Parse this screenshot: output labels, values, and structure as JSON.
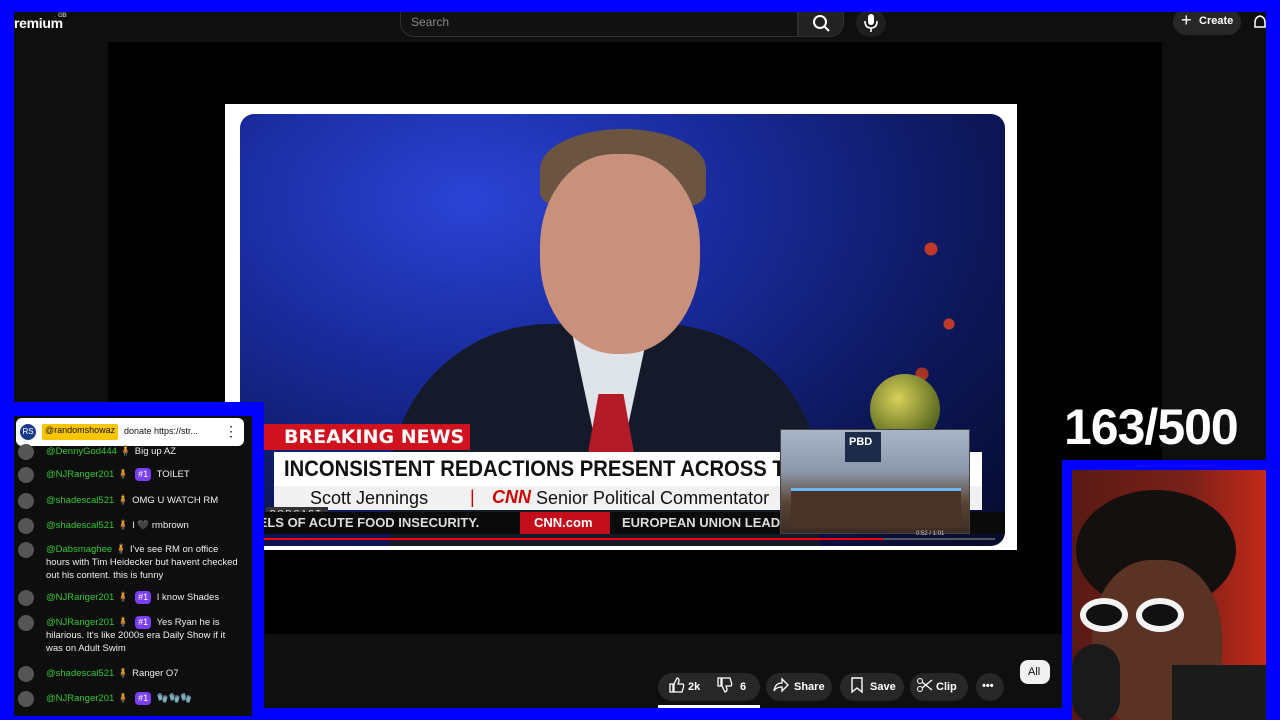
{
  "topbar": {
    "logo": "remium",
    "logo_sup": "GB",
    "search_placeholder": "Search",
    "create_label": "Create"
  },
  "video": {
    "breaking": "BREAKING NEWS",
    "headline": "INCONSISTENT REDACTIONS PRESENT ACROSS THE EPS",
    "subline_name": "Scott Jennings",
    "subline_sep": "|",
    "network": "CNN",
    "subline_title": "Senior Political Commentator",
    "podcast_tag": "PODCAST",
    "ticker_left": "VELS OF ACUTE FOOD INSECURITY.",
    "ticker_site": "CNN.com",
    "ticker_right": "EUROPEAN UNION LEADERS EARLY PREVENTION",
    "inset_brand": "PBD",
    "time": "0:52 / 1:01",
    "progress": 0.85
  },
  "actions": {
    "like_count": "2k",
    "dislike_count": "6",
    "share": "Share",
    "save": "Save",
    "clip": "Clip",
    "more": "•••",
    "all_chip": "All"
  },
  "chat": {
    "pinned": {
      "avatar": "RS",
      "user": "@randomshowaz",
      "text": "donate",
      "link": "https://str..."
    },
    "messages": [
      {
        "user": "@DennyGod444",
        "text": "Big up AZ",
        "badge": ""
      },
      {
        "user": "@NJRanger201",
        "text": "TOILET",
        "badge": "#1"
      },
      {
        "user": "@shadescal521",
        "text": "OMG U WATCH RM",
        "badge": ""
      },
      {
        "user": "@shadescal521",
        "text": "I 🖤 rmbrown",
        "badge": ""
      },
      {
        "user": "@Dabsmaghee",
        "text": "I've see RM on office hours with Tim Heidecker but havent checked out his content. this is funny",
        "badge": ""
      },
      {
        "user": "@NJRanger201",
        "text": "I know Shades",
        "badge": "#1"
      },
      {
        "user": "@NJRanger201",
        "text": "Yes Ryan he is hilarious. It's like 2000s era Daily Show if it was on Adult Swim",
        "badge": "#1"
      },
      {
        "user": "@shadescal521",
        "text": "Ranger O7",
        "badge": ""
      },
      {
        "user": "@NJRanger201",
        "text": "🧤🧤🧤",
        "badge": "#1"
      }
    ]
  },
  "counter": "163/500",
  "colors": {
    "frame_blue": "#0000ff",
    "breaking_red": "#d0121f",
    "chat_username": "#34c734",
    "badge_purple": "#7b3ff2",
    "pinned_highlight": "#f8c600"
  },
  "icons": [
    "search-icon",
    "mic-icon",
    "plus-icon",
    "bell-icon",
    "thumbs-up-icon",
    "thumbs-down-icon",
    "share-icon",
    "bookmark-icon",
    "scissors-icon",
    "more-icon",
    "crown-icon",
    "kebab-menu-icon"
  ]
}
